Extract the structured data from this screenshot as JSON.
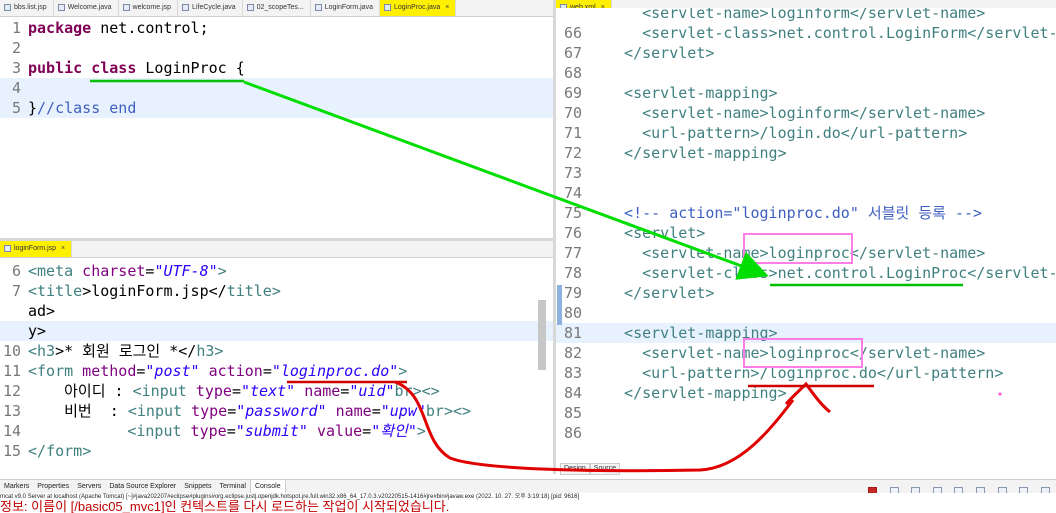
{
  "top_tabs": [
    {
      "label": "bbs.list.jsp",
      "active": false
    },
    {
      "label": "Welcome.java",
      "active": false
    },
    {
      "label": "welcome.jsp",
      "active": false
    },
    {
      "label": "LifeCycle.java",
      "active": false
    },
    {
      "label": "02_scopeTes...",
      "active": false
    },
    {
      "label": "LoginForm.java",
      "active": false
    },
    {
      "label": "LoginProc.java",
      "active": true
    }
  ],
  "right_tab": {
    "label": "web.xml"
  },
  "login_form_tab": {
    "label": "loginForm.jsp"
  },
  "close_glyph": "×",
  "java_editor": {
    "lines": [
      {
        "n": "1",
        "kw": "package",
        "rest": " net.control;"
      },
      {
        "n": "2"
      },
      {
        "n": "3",
        "kw": "public",
        "kw2": "class",
        "rest": " LoginProc {"
      },
      {
        "n": "4"
      },
      {
        "n": "5",
        "brace": "}",
        "comment": "//class end"
      }
    ]
  },
  "jsp_editor": {
    "lines": [
      {
        "n": "6",
        "p1": "<",
        "t1": "meta",
        "a1": " charset",
        "eq": "=",
        "v1": "\"UTF-8\"",
        "end": ">"
      },
      {
        "n": "7",
        "p1": "<",
        "t1": "title",
        "text": ">loginForm.jsp</",
        "t2": "title",
        "end": ">"
      },
      {
        "n": "",
        "text": "ad>"
      },
      {
        "n": "",
        "text": "y>"
      },
      {
        "n": "10",
        "p1": "<",
        "t1": "h3",
        "text": ">* 회원 로그인 *</",
        "t2": "h3",
        "end": ">"
      },
      {
        "n": "11",
        "p1": "<",
        "t1": "form",
        "a1": " method",
        "eq": "=",
        "v1": "\"post\"",
        "a2": " action",
        "eq2": "=",
        "v2": "\"loginproc.do\"",
        "end": ">"
      },
      {
        "n": "12",
        "pre": "    아이디 : ",
        "p1": "<",
        "t1": "input",
        "a1": " type",
        "eq": "=",
        "v1": "\"text\"",
        "a2": " name",
        "eq2": "=",
        "v2": "\"uid\"",
        "end": "><",
        "t2": "br",
        "end2": ">"
      },
      {
        "n": "13",
        "pre": "    비번  : ",
        "p1": "<",
        "t1": "input",
        "a1": " type",
        "eq": "=",
        "v1": "\"password\"",
        "a2": " name",
        "eq2": "=",
        "v2": "\"upw\"",
        "end": "><",
        "t2": "br",
        "end2": ">"
      },
      {
        "n": "14",
        "pre": "           ",
        "p1": "<",
        "t1": "input",
        "a1": " type",
        "eq": "=",
        "v1": "\"submit\"",
        "a2": " value",
        "eq2": "=",
        "v2": "\"확인\"",
        "end": ">"
      },
      {
        "n": "15",
        "p1": "</",
        "t1": "form",
        "end": ">"
      }
    ]
  },
  "xml_editor": {
    "lines": [
      {
        "n": "",
        "text": "    <servlet-name>loginform</servlet-name>"
      },
      {
        "n": "66",
        "text": "    <servlet-class>net.control.LoginForm</servlet-class>"
      },
      {
        "n": "67",
        "text": "  </servlet>"
      },
      {
        "n": "68",
        "text": ""
      },
      {
        "n": "69",
        "text": "  <servlet-mapping>"
      },
      {
        "n": "70",
        "text": "    <servlet-name>loginform</servlet-name>"
      },
      {
        "n": "71",
        "text": "    <url-pattern>/login.do</url-pattern>"
      },
      {
        "n": "72",
        "text": "  </servlet-mapping>"
      },
      {
        "n": "73",
        "text": ""
      },
      {
        "n": "74",
        "text": ""
      },
      {
        "n": "75",
        "text": "  <!-- action=\"loginproc.do\" 서블릿 등록 -->"
      },
      {
        "n": "76",
        "text": "  <servlet>"
      },
      {
        "n": "77",
        "text": "    <servlet-name>loginproc</servlet-name>"
      },
      {
        "n": "78",
        "text": "    <servlet-class>net.control.LoginProc</servlet-class>"
      },
      {
        "n": "79",
        "text": "  </servlet>"
      },
      {
        "n": "80",
        "text": ""
      },
      {
        "n": "81",
        "text": "  <servlet-mapping>"
      },
      {
        "n": "82",
        "text": "    <servlet-name>loginproc</servlet-name>"
      },
      {
        "n": "83",
        "text": "    <url-pattern>/loginproc.do</url-pattern>"
      },
      {
        "n": "84",
        "text": "  </servlet-mapping>"
      },
      {
        "n": "85",
        "text": ""
      },
      {
        "n": "86",
        "text": ""
      }
    ]
  },
  "design_tabs": [
    "Design",
    "Source"
  ],
  "views": [
    {
      "label": "Markers",
      "active": false
    },
    {
      "label": "Properties",
      "active": false
    },
    {
      "label": "Servers",
      "active": false
    },
    {
      "label": "Data Source Explorer",
      "active": false
    },
    {
      "label": "Snippets",
      "active": false
    },
    {
      "label": "Terminal",
      "active": false
    },
    {
      "label": "Console",
      "active": true
    }
  ],
  "server_status": "mcat v9.0 Server at localhost (Apache Tomcat) [~]#java202207#eclipse#plugins#org.eclipse.justj.openjdk.hotspot.jre.full.win32.x86_64_17.0.3.v20220515-1416#jre#bin#javaw.exe  (2022. 10. 27. 오후 3:19:18) [pid: 9616]",
  "console_text": "정보: 이름이 [/basic05_mvc1]인 컨텍스트를 다시 로드하는 작업이 시작되었습니다.",
  "colors": {
    "arrow_green": "#00dd00",
    "arrow_red": "#e00000",
    "highlight_box": "#ff7de6",
    "underline_green": "#00c000",
    "underline_red": "#d00000",
    "active_tab": "#ffef00"
  }
}
